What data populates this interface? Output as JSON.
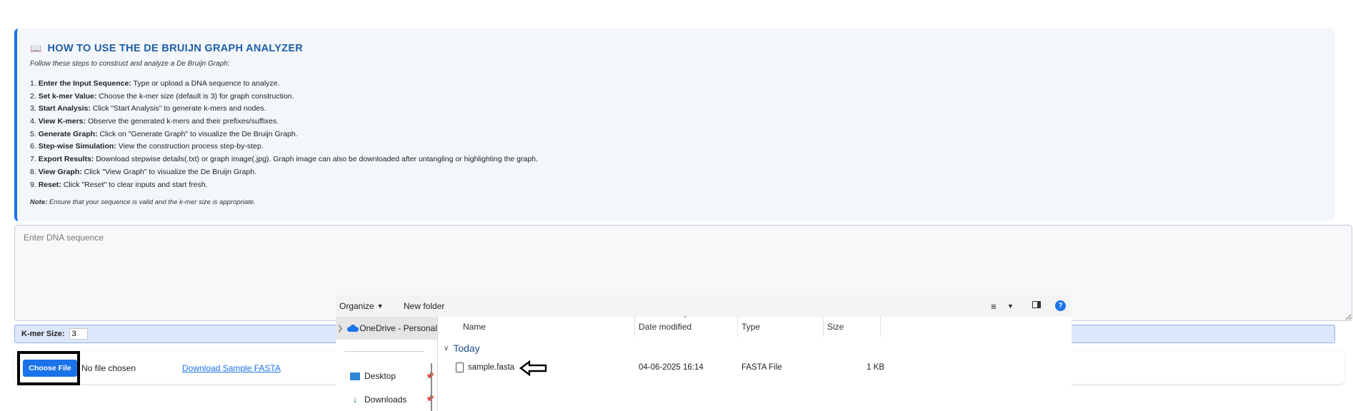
{
  "instructions": {
    "title": "HOW TO USE THE DE BRUIJN GRAPH ANALYZER",
    "intro": "Follow these steps to construct and analyze a De Bruijn Graph:",
    "steps": [
      {
        "num": "1.",
        "label": "Enter the Input Sequence:",
        "text": " Type or upload a DNA sequence to analyze."
      },
      {
        "num": "2.",
        "label": "Set k-mer Value:",
        "text": " Choose the k-mer size (default is 3) for graph construction."
      },
      {
        "num": "3.",
        "label": "Start Analysis:",
        "text": " Click \"Start Analysis\" to generate k-mers and nodes."
      },
      {
        "num": "4.",
        "label": "View K-mers:",
        "text": " Observe the generated k-mers and their prefixes/suffixes."
      },
      {
        "num": "5.",
        "label": "Generate Graph:",
        "text": " Click on \"Generate Graph\" to visualize the De Bruijn Graph."
      },
      {
        "num": "6.",
        "label": "Step-wise Simulation:",
        "text": " View the construction process step-by-step."
      },
      {
        "num": "7.",
        "label": "Export Results:",
        "text": " Download stepwise details(.txt) or graph image(.jpg). Graph image can also be downloaded after untangling or highlighting the graph."
      },
      {
        "num": "8.",
        "label": "View Graph:",
        "text": " Click \"View Graph\" to visualize the De Bruijn Graph."
      },
      {
        "num": "9.",
        "label": "Reset:",
        "text": " Click \"Reset\" to clear inputs and start fresh."
      }
    ],
    "note_label": "Note:",
    "note_text": " Ensure that your sequence is valid and the k-mer size is appropriate."
  },
  "dna_input": {
    "placeholder": "Enter DNA sequence",
    "value": ""
  },
  "kmer": {
    "label": "K-mer Size:",
    "value": "3"
  },
  "upload": {
    "button_label": "Choose File",
    "status": "No file chosen",
    "sample_link": "Download Sample FASTA"
  },
  "file_dialog": {
    "toolbar": {
      "organize_label": "Organize",
      "new_folder_label": "New folder",
      "help_label": "?"
    },
    "nav": [
      {
        "label": "OneDrive - Personal",
        "icon": "cloud-icon",
        "selected": true
      },
      {
        "label": "Desktop",
        "icon": "desktop-icon",
        "pinned": true
      },
      {
        "label": "Downloads",
        "icon": "downloads-icon",
        "pinned": true
      }
    ],
    "columns": [
      "Name",
      "Date modified",
      "Type",
      "Size"
    ],
    "group_label": "Today",
    "files": [
      {
        "name": "sample.fasta",
        "date": "04-06-2025 16:14",
        "type": "FASTA File",
        "size": "1 KB"
      }
    ]
  },
  "colors": {
    "accent": "#1a73e8",
    "title": "#1f5ea8",
    "panel_bg": "#f3f6fa",
    "kmer_bg": "#dce7fb"
  }
}
